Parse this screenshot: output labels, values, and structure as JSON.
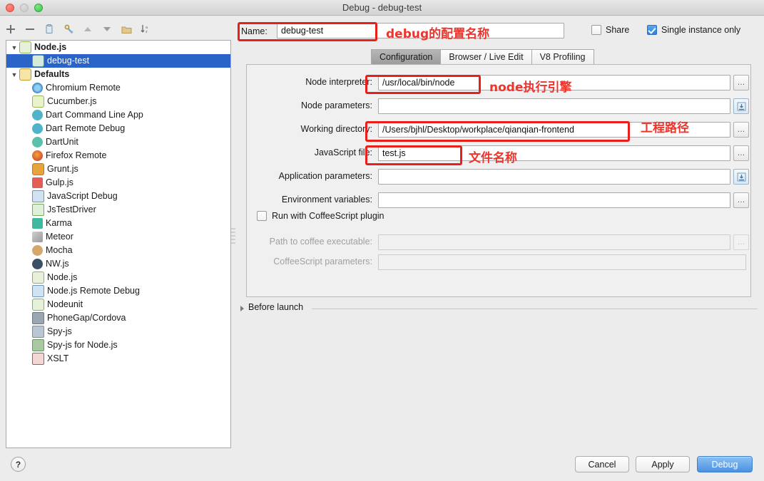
{
  "window": {
    "title": "Debug - debug-test",
    "traffic_lights": [
      "close",
      "minimize",
      "zoom"
    ]
  },
  "toolbar": {
    "buttons": [
      {
        "name": "add-icon",
        "label": "+"
      },
      {
        "name": "remove-icon",
        "label": "−"
      },
      {
        "name": "copy-icon",
        "label": "Copy"
      },
      {
        "name": "edit-defaults-icon",
        "label": "Edit defaults"
      },
      {
        "name": "move-up-icon",
        "label": "Move up"
      },
      {
        "name": "move-down-icon",
        "label": "Move down"
      },
      {
        "name": "folder-icon",
        "label": "Create folder"
      },
      {
        "name": "sort-alphabetically-icon",
        "label": "Sort"
      }
    ]
  },
  "tree": {
    "nodes": [
      {
        "label": "Node.js",
        "type": "group",
        "expanded": true,
        "icon": "ic-node",
        "depth": 0,
        "selected": false
      },
      {
        "label": "debug-test",
        "type": "leaf",
        "icon": "ic-nodejs-s",
        "depth": 1,
        "selected": true
      },
      {
        "label": "Defaults",
        "type": "group",
        "expanded": true,
        "icon": "ic-wrench",
        "depth": 0,
        "selected": false
      },
      {
        "label": "Chromium Remote",
        "type": "leaf",
        "icon": "ic-chrome",
        "depth": 1,
        "selected": false
      },
      {
        "label": "Cucumber.js",
        "type": "leaf",
        "icon": "ic-cucumber",
        "depth": 1,
        "selected": false
      },
      {
        "label": "Dart Command Line App",
        "type": "leaf",
        "icon": "ic-dart",
        "depth": 1,
        "selected": false
      },
      {
        "label": "Dart Remote Debug",
        "type": "leaf",
        "icon": "ic-dart",
        "depth": 1,
        "selected": false
      },
      {
        "label": "DartUnit",
        "type": "leaf",
        "icon": "ic-dart2",
        "depth": 1,
        "selected": false
      },
      {
        "label": "Firefox Remote",
        "type": "leaf",
        "icon": "ic-firefox",
        "depth": 1,
        "selected": false
      },
      {
        "label": "Grunt.js",
        "type": "leaf",
        "icon": "ic-grunt",
        "depth": 1,
        "selected": false
      },
      {
        "label": "Gulp.js",
        "type": "leaf",
        "icon": "ic-gulp",
        "depth": 1,
        "selected": false
      },
      {
        "label": "JavaScript Debug",
        "type": "leaf",
        "icon": "ic-jsdebug",
        "depth": 1,
        "selected": false
      },
      {
        "label": "JsTestDriver",
        "type": "leaf",
        "icon": "ic-jstd",
        "depth": 1,
        "selected": false
      },
      {
        "label": "Karma",
        "type": "leaf",
        "icon": "ic-karma",
        "depth": 1,
        "selected": false
      },
      {
        "label": "Meteor",
        "type": "leaf",
        "icon": "ic-meteor",
        "depth": 1,
        "selected": false
      },
      {
        "label": "Mocha",
        "type": "leaf",
        "icon": "ic-mocha",
        "depth": 1,
        "selected": false
      },
      {
        "label": "NW.js",
        "type": "leaf",
        "icon": "ic-nw",
        "depth": 1,
        "selected": false
      },
      {
        "label": "Node.js",
        "type": "leaf",
        "icon": "ic-node",
        "depth": 1,
        "selected": false
      },
      {
        "label": "Node.js Remote Debug",
        "type": "leaf",
        "icon": "ic-jsdebug",
        "depth": 1,
        "selected": false
      },
      {
        "label": "Nodeunit",
        "type": "leaf",
        "icon": "ic-node",
        "depth": 1,
        "selected": false
      },
      {
        "label": "PhoneGap/Cordova",
        "type": "leaf",
        "icon": "ic-phonegap",
        "depth": 1,
        "selected": false
      },
      {
        "label": "Spy-js",
        "type": "leaf",
        "icon": "ic-spyjs",
        "depth": 1,
        "selected": false
      },
      {
        "label": "Spy-js for Node.js",
        "type": "leaf",
        "icon": "ic-spyjsn",
        "depth": 1,
        "selected": false
      },
      {
        "label": "XSLT",
        "type": "leaf",
        "icon": "ic-xslt",
        "depth": 1,
        "selected": false
      }
    ]
  },
  "name_row": {
    "label": "Name:",
    "value": "debug-test",
    "share": {
      "label": "Share",
      "checked": false
    },
    "single_instance": {
      "label": "Single instance only",
      "checked": true
    }
  },
  "tabs": [
    {
      "label": "Configuration",
      "active": true
    },
    {
      "label": "Browser / Live Edit",
      "active": false
    },
    {
      "label": "V8 Profiling",
      "active": false
    }
  ],
  "form": {
    "fields": [
      {
        "label": "Node interpreter:",
        "value": "/usr/local/bin/node",
        "disabled": false,
        "button": "dots"
      },
      {
        "label": "Node parameters:",
        "value": "",
        "disabled": false,
        "button": "insert"
      },
      {
        "label": "Working directory:",
        "value": "/Users/bjhl/Desktop/workplace/qianqian-frontend",
        "disabled": false,
        "button": "dots"
      },
      {
        "label": "JavaScript file:",
        "value": "test.js",
        "disabled": false,
        "button": "dots"
      },
      {
        "label": "Application parameters:",
        "value": "",
        "disabled": false,
        "button": "insert"
      },
      {
        "label": "Environment variables:",
        "value": "",
        "disabled": false,
        "button": "dots"
      },
      {
        "label": "Path to coffee executable:",
        "value": "",
        "disabled": true,
        "button": "dots"
      },
      {
        "label": "CoffeeScript parameters:",
        "value": "",
        "disabled": true,
        "button": "none"
      }
    ],
    "coffee_checkbox": {
      "label": "Run with CoffeeScript plugin",
      "checked": false
    }
  },
  "before_launch": {
    "label": "Before launch",
    "expanded": false
  },
  "bottom": {
    "help": "?",
    "cancel": "Cancel",
    "apply": "Apply",
    "debug": "Debug"
  },
  "annotations": {
    "color": "#ef342c",
    "items": [
      {
        "name": "annotation-name-field",
        "text": "debug的配置名称"
      },
      {
        "name": "annotation-node-interpreter",
        "text": "node执行引擎"
      },
      {
        "name": "annotation-working-directory",
        "text": "工程路径"
      },
      {
        "name": "annotation-javascript-file",
        "text": "文件名称"
      }
    ]
  }
}
